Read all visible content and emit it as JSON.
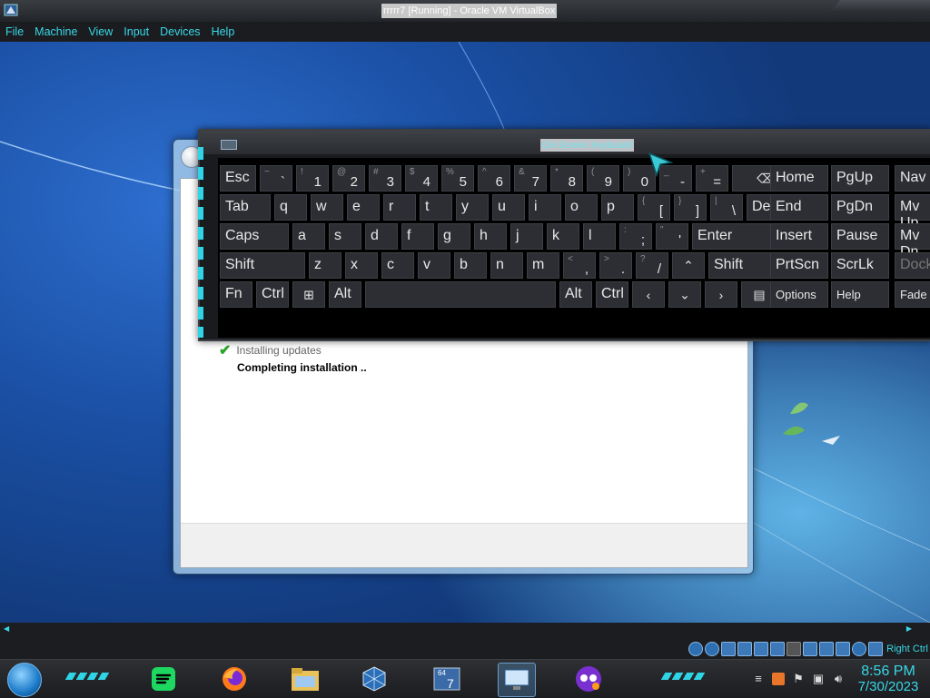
{
  "host_window": {
    "title": "rrrrr7 [Running] - Oracle VM VirtualBox",
    "menu": [
      "File",
      "Machine",
      "View",
      "Input",
      "Devices",
      "Help"
    ],
    "host_key_label": "Right Ctrl"
  },
  "update_dialog": {
    "steps": [
      {
        "label": "Installing updates",
        "status": "done"
      },
      {
        "label": "Completing installation ..",
        "status": "active"
      }
    ]
  },
  "osk": {
    "title": "On-Screen Keyboard",
    "rows": [
      [
        {
          "main": "Esc"
        },
        {
          "shift": "~",
          "lower": "`"
        },
        {
          "shift": "!",
          "lower": "1"
        },
        {
          "shift": "@",
          "lower": "2"
        },
        {
          "shift": "#",
          "lower": "3"
        },
        {
          "shift": "$",
          "lower": "4"
        },
        {
          "shift": "%",
          "lower": "5"
        },
        {
          "shift": "^",
          "lower": "6"
        },
        {
          "shift": "&",
          "lower": "7"
        },
        {
          "shift": "*",
          "lower": "8"
        },
        {
          "shift": "(",
          "lower": "9"
        },
        {
          "shift": ")",
          "lower": "0"
        },
        {
          "shift": "_",
          "lower": "-"
        },
        {
          "shift": "+",
          "lower": "="
        },
        {
          "glyph": "⌫"
        }
      ],
      [
        {
          "main": "Tab"
        },
        {
          "main": "q"
        },
        {
          "main": "w"
        },
        {
          "main": "e"
        },
        {
          "main": "r"
        },
        {
          "main": "t"
        },
        {
          "main": "y"
        },
        {
          "main": "u"
        },
        {
          "main": "i"
        },
        {
          "main": "o"
        },
        {
          "main": "p"
        },
        {
          "shift": "{",
          "lower": "["
        },
        {
          "shift": "}",
          "lower": "]"
        },
        {
          "shift": "|",
          "lower": "\\"
        },
        {
          "main": "Del"
        }
      ],
      [
        {
          "main": "Caps"
        },
        {
          "main": "a"
        },
        {
          "main": "s"
        },
        {
          "main": "d"
        },
        {
          "main": "f"
        },
        {
          "main": "g"
        },
        {
          "main": "h"
        },
        {
          "main": "j"
        },
        {
          "main": "k"
        },
        {
          "main": "l"
        },
        {
          "shift": ":",
          "lower": ";"
        },
        {
          "shift": "\"",
          "lower": "'"
        },
        {
          "main": "Enter"
        }
      ],
      [
        {
          "main": "Shift"
        },
        {
          "main": "z"
        },
        {
          "main": "x"
        },
        {
          "main": "c"
        },
        {
          "main": "v"
        },
        {
          "main": "b"
        },
        {
          "main": "n"
        },
        {
          "main": "m"
        },
        {
          "shift": "<",
          "lower": ","
        },
        {
          "shift": ">",
          "lower": "."
        },
        {
          "shift": "?",
          "lower": "/"
        },
        {
          "glyph": "⌃"
        },
        {
          "main": "Shift"
        }
      ],
      [
        {
          "main": "Fn"
        },
        {
          "main": "Ctrl"
        },
        {
          "glyph": "⊞"
        },
        {
          "main": "Alt"
        },
        {
          "main": ""
        },
        {
          "main": "Alt"
        },
        {
          "main": "Ctrl"
        },
        {
          "glyph": "‹"
        },
        {
          "glyph": "⌄"
        },
        {
          "glyph": "›"
        },
        {
          "glyph": "▤"
        }
      ]
    ],
    "nav_keys": [
      [
        "Home",
        "PgUp",
        "Nav"
      ],
      [
        "End",
        "PgDn",
        "Mv Up"
      ],
      [
        "Insert",
        "Pause",
        "Mv Dn"
      ],
      [
        "PrtScn",
        "ScrLk",
        "Dock"
      ],
      [
        "Options",
        "Help",
        "Fade"
      ]
    ]
  },
  "taskbar": {
    "apps": [
      "spotify-icon",
      "firefox-icon",
      "file-explorer-icon",
      "virtualbox-icon",
      "win7-vm-icon",
      "remote-desktop-icon",
      "privacy-app-icon"
    ],
    "clock": {
      "time": "8:56 PM",
      "date": "7/30/2023"
    }
  },
  "colors": {
    "accent": "#38d8e8",
    "key_bg": "#2c2e33",
    "desktop": "#1a4fa3"
  }
}
